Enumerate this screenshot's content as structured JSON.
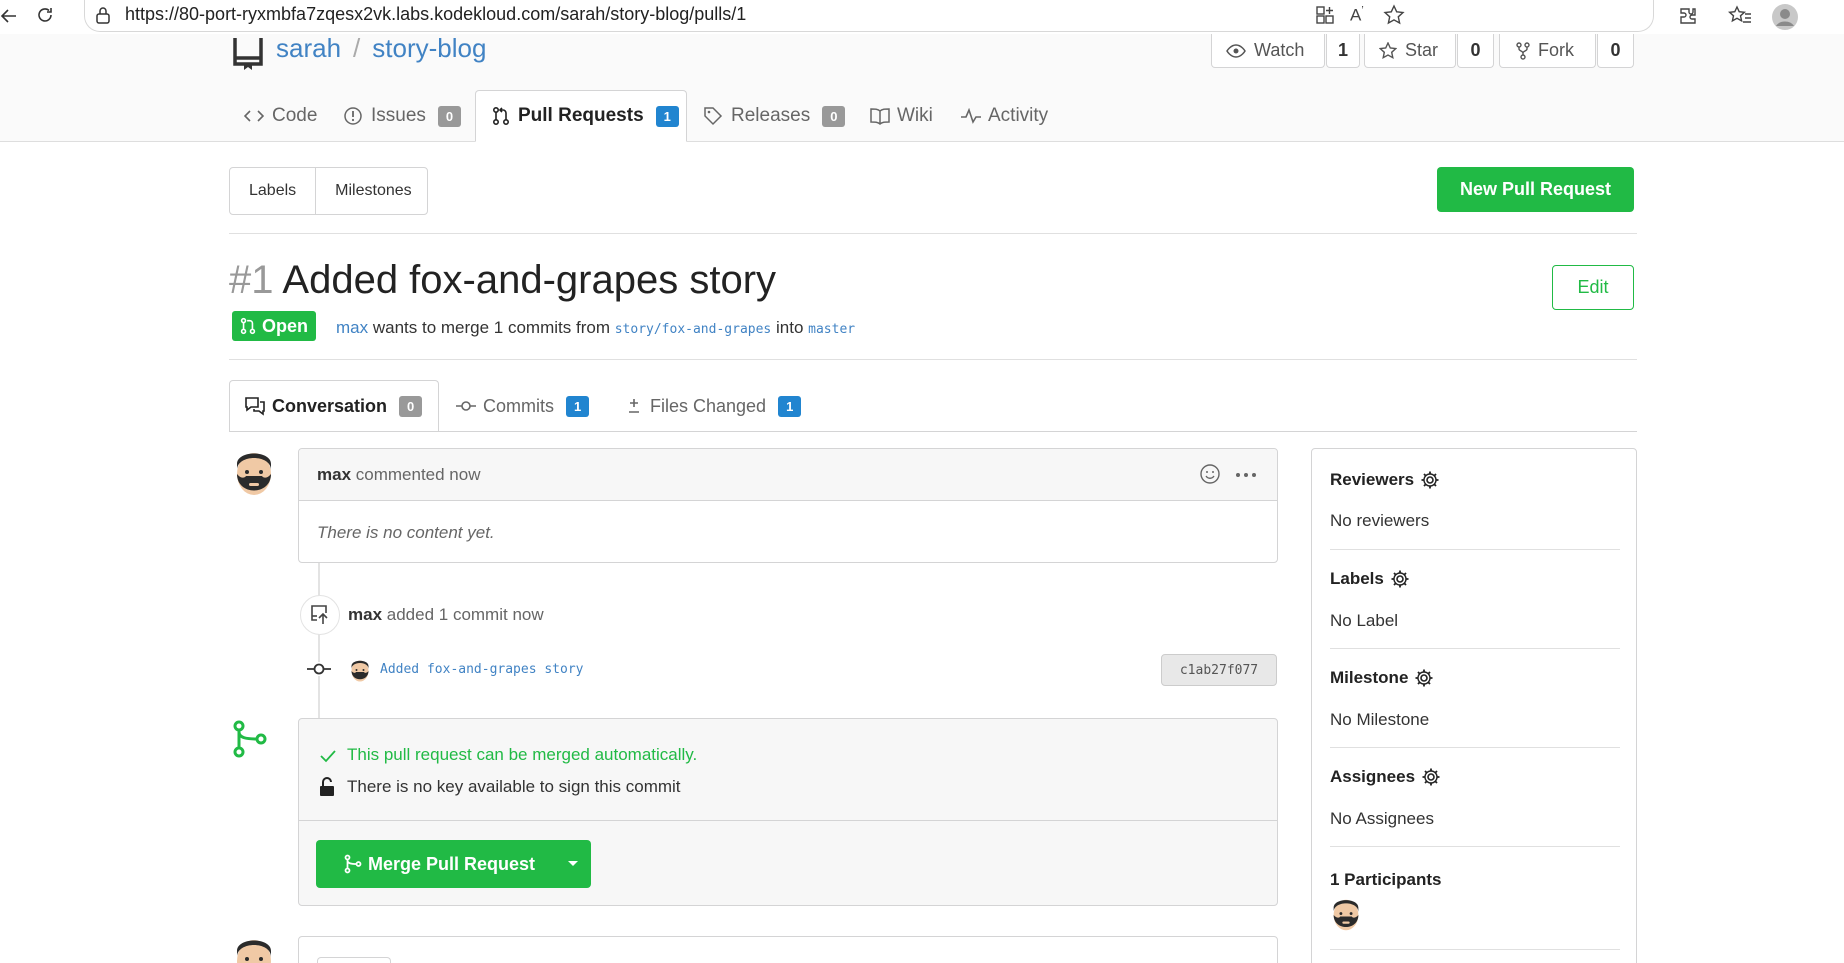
{
  "browser": {
    "url": "https://80-port-ryxmbfa7zqesx2vk.labs.kodekloud.com/sarah/story-blog/pulls/1"
  },
  "repo": {
    "owner": "sarah",
    "separator": "/",
    "name": "story-blog",
    "watch_label": "Watch",
    "watch_count": "1",
    "star_label": "Star",
    "star_count": "0",
    "fork_label": "Fork",
    "fork_count": "0"
  },
  "repo_tabs": {
    "code": "Code",
    "issues": "Issues",
    "issues_count": "0",
    "pulls": "Pull Requests",
    "pulls_count": "1",
    "releases": "Releases",
    "releases_count": "0",
    "wiki": "Wiki",
    "activity": "Activity"
  },
  "toolbar": {
    "labels": "Labels",
    "milestones": "Milestones",
    "new_pr": "New Pull Request"
  },
  "pr": {
    "number": "#1",
    "title": "Added fox-and-grapes story",
    "edit_label": "Edit",
    "status": "Open",
    "author": "max",
    "merge_text": "wants to merge 1 commits from",
    "head_branch": "story/fox-and-grapes",
    "into": "into",
    "base_branch": "master"
  },
  "pr_tabs": {
    "conversation": "Conversation",
    "conversation_count": "0",
    "commits": "Commits",
    "commits_count": "1",
    "files": "Files Changed",
    "files_count": "1"
  },
  "comment": {
    "author": "max",
    "action": "commented now",
    "body": "There is no content yet."
  },
  "push": {
    "author": "max",
    "action": "added 1 commit now",
    "commit_message": "Added fox-and-grapes story",
    "sha": "c1ab27f077"
  },
  "merge": {
    "ok_text": "This pull request can be merged automatically.",
    "key_text": "There is no key available to sign this commit",
    "button": "Merge Pull Request"
  },
  "sidebar": {
    "reviewers_title": "Reviewers",
    "reviewers_value": "No reviewers",
    "labels_title": "Labels",
    "labels_value": "No Label",
    "milestone_title": "Milestone",
    "milestone_value": "No Milestone",
    "assignees_title": "Assignees",
    "assignees_value": "No Assignees",
    "participants_title": "1 Participants"
  },
  "colors": {
    "green": "#21ba45",
    "link_blue": "#4183c4",
    "badge_blue": "#2185d0"
  }
}
